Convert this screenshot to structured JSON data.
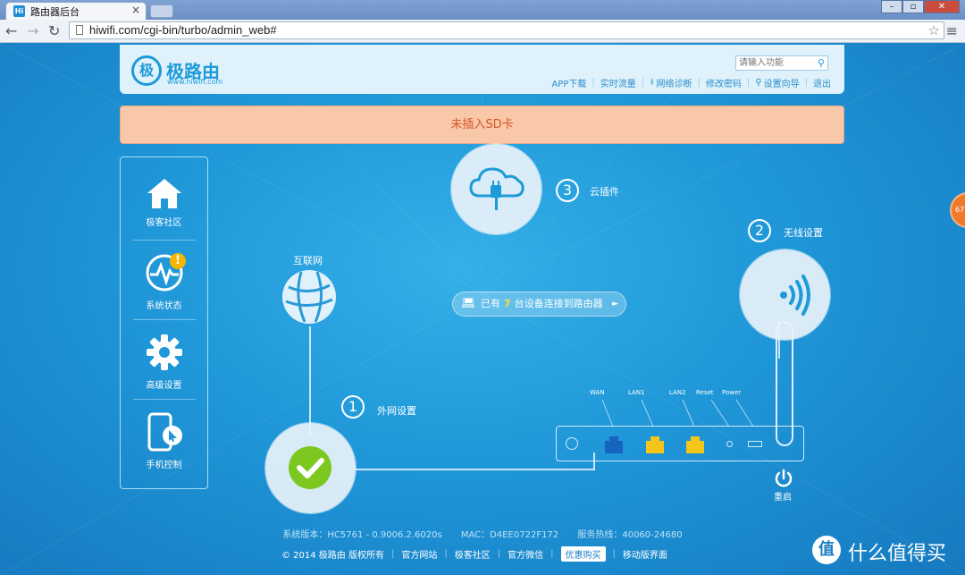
{
  "browser": {
    "tab_title": "路由器后台",
    "tab_favicon": "Hi",
    "url": "hiwifi.com/cgi-bin/turbo/admin_web#"
  },
  "header": {
    "logo_mark": "极",
    "logo_name": "极路由",
    "logo_url": "www.hiwifi.com",
    "search_placeholder": "请输入功能",
    "links": [
      "APP下载",
      "实时流量",
      "网络诊断",
      "修改密码",
      "设置向导",
      "退出"
    ]
  },
  "banner": {
    "text": "未插入SD卡"
  },
  "sidebar": {
    "items": [
      {
        "label": "极客社区",
        "icon": "home-icon"
      },
      {
        "label": "系统状态",
        "icon": "pulse-icon",
        "alert": "!"
      },
      {
        "label": "高级设置",
        "icon": "gear-icon"
      },
      {
        "label": "手机控制",
        "icon": "phone-icon"
      }
    ]
  },
  "steps": {
    "s1": {
      "num": "1",
      "label": "外网设置"
    },
    "s2": {
      "num": "2",
      "label": "无线设置"
    },
    "s3": {
      "num": "3",
      "label": "云插件"
    },
    "internet_label": "互联网"
  },
  "devices": {
    "prefix": "已有",
    "count": "7",
    "suffix": "台设备连接到路由器",
    "arrow": "►"
  },
  "router": {
    "ports": [
      "WAN",
      "LAN1",
      "LAN2",
      "Reset",
      "Power"
    ],
    "reboot_label": "重启"
  },
  "footer": {
    "version": "系统版本：HC5761 - 0.9006.2.6020s",
    "mac": "MAC：D4EE0722F172",
    "hotline": "服务热线：40060-24680",
    "copyright": "© 2014 极路由 版权所有",
    "links": [
      "官方网站",
      "极客社区",
      "官方微信"
    ],
    "deal": "优惠购买",
    "mobile": "移动版界面"
  },
  "edge_badge": "67",
  "watermark": {
    "mark": "值",
    "text": "什么值得买"
  },
  "colors": {
    "accent": "#1d9ad8",
    "banner_bg": "#f8c8a8",
    "banner_text": "#d4542a",
    "ok_green": "#7cc820",
    "lan_port": "#f5c518",
    "wan_port": "#1565c0"
  }
}
